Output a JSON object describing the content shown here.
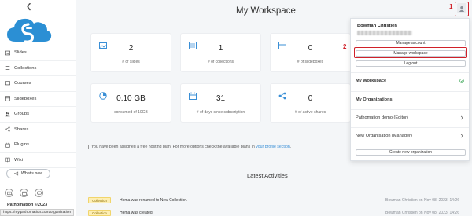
{
  "sidebar": {
    "collapse_icon": "chevron-left-icon",
    "items": [
      {
        "label": "Slides",
        "icon": "image-icon"
      },
      {
        "label": "Collections",
        "icon": "list-icon"
      },
      {
        "label": "Courses",
        "icon": "monitor-icon"
      },
      {
        "label": "Slideboxes",
        "icon": "box-icon"
      },
      {
        "label": "Groups",
        "icon": "users-icon"
      },
      {
        "label": "Shares",
        "icon": "share-icon"
      },
      {
        "label": "Plugins",
        "icon": "plugin-icon"
      },
      {
        "label": "Wiki",
        "icon": "book-icon"
      }
    ],
    "whats_new": "What's new",
    "copyright": "Pathomation ©2023"
  },
  "status_url": "https://my.pathomation.com/organization",
  "header": {
    "title": "My Workspace",
    "marker1": "1",
    "marker2": "2"
  },
  "stats": [
    {
      "value": "2",
      "label": "# of slides",
      "icon": "image-icon"
    },
    {
      "value": "1",
      "label": "# of collections",
      "icon": "list-icon"
    },
    {
      "value": "0",
      "label": "# of slideboxes",
      "icon": "box-icon"
    },
    {
      "value": "0.10 GB",
      "label": "consumed of 10GB",
      "icon": "pie-chart-icon"
    },
    {
      "value": "31",
      "label": "# of days since subscription",
      "icon": "calendar-icon"
    },
    {
      "value": "0",
      "label": "# of active shares",
      "icon": "share-icon"
    }
  ],
  "plan_note": {
    "text": "You have been assigned a free hosting plan. For more options check the available plans in ",
    "link": "your profile section",
    "end": "."
  },
  "activities": {
    "title": "Latest Activities",
    "rows": [
      {
        "badge": "Collection",
        "text": "Hema was renamed to New Collection.",
        "who": "Bowman Christien on Nov 08, 2023, 14:26"
      },
      {
        "badge": "Collection",
        "text": "Hema was created.",
        "who": "Bowman Christien on Nov 08, 2023, 14:26"
      }
    ]
  },
  "account_menu": {
    "user_name": "Bowman Christien",
    "manage_account": "Manage account",
    "manage_workspace": "Manage workspace",
    "logout": "Log out",
    "my_workspace": "My Workspace",
    "my_organizations": "My Organizations",
    "orgs": [
      {
        "label": "Pathomation demo (Editor)"
      },
      {
        "label": "New Organisation (Manager)"
      }
    ],
    "create_org": "Create new organization"
  },
  "colors": {
    "accent": "#3a8fd6",
    "highlight": "#d0212a",
    "badge_bg": "#fdeeb4",
    "check": "#3aa655"
  }
}
